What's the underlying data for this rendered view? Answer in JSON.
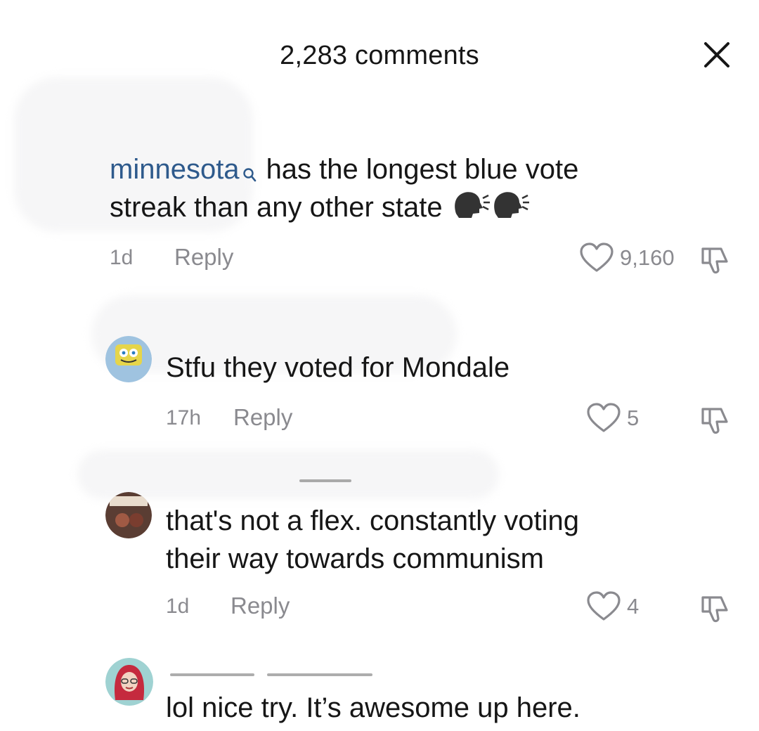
{
  "header": {
    "title": "2,283 comments",
    "close_icon": "close-icon"
  },
  "comments": [
    {
      "username": "minnesota",
      "text_line1": "has the longest blue vote",
      "text_line2": "streak than any other state",
      "emoji": "speaking-head-emoji",
      "time": "1d",
      "reply_label": "Reply",
      "likes": "9,160"
    },
    {
      "text": "Stfu they voted for Mondale",
      "time": "17h",
      "reply_label": "Reply",
      "likes": "5"
    },
    {
      "text_line1": "that's not a flex. constantly voting",
      "text_line2": "their way towards communism",
      "time": "1d",
      "reply_label": "Reply",
      "likes": "4"
    },
    {
      "text": "lol nice try. It’s awesome up here."
    }
  ],
  "colors": {
    "username": "#2e5a8c",
    "meta": "#8a8a8f",
    "text": "#161616"
  }
}
